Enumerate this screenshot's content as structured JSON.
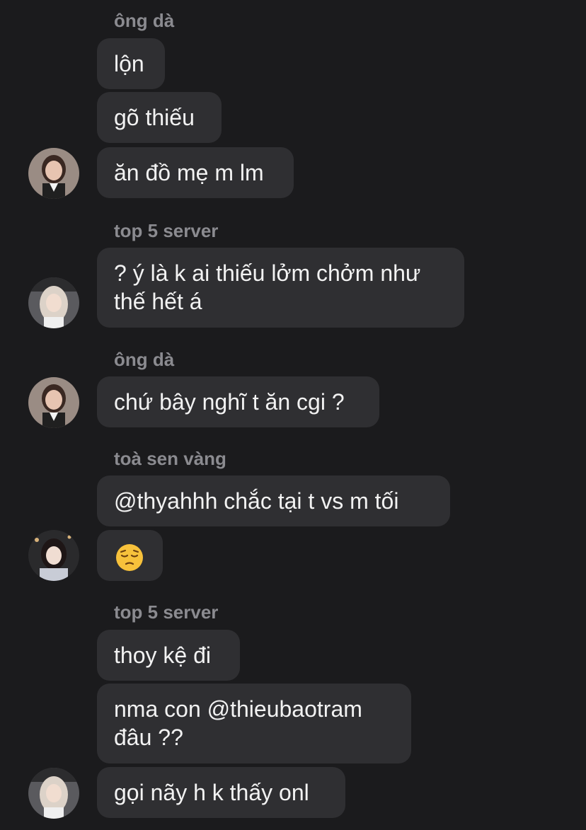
{
  "messages": [
    {
      "sender": "ông dà"
    },
    {
      "text": "lộn"
    },
    {
      "text": "gõ thiếu"
    },
    {
      "text": "ăn đồ mẹ m lm"
    },
    {
      "sender": "top 5 server"
    },
    {
      "line1": "? ý là k ai thiếu lởm chởm như",
      "line2": "thế hết á"
    },
    {
      "sender": "ông dà"
    },
    {
      "text": "chứ bây nghĩ t ăn cgi ?"
    },
    {
      "sender": "toà sen vàng"
    },
    {
      "text": "@thyahhh chắc tại t vs m tối"
    },
    {
      "emoji": "pensive-face"
    },
    {
      "sender": "top 5 server"
    },
    {
      "text": "thoy kệ đi"
    },
    {
      "line1": "nma con @thieubaotram",
      "line2": "đâu ??"
    },
    {
      "text": "gọi nãy h k thấy onl"
    }
  ],
  "colors": {
    "background": "#1b1b1d",
    "bubble": "#2f2f32",
    "sender_name": "#8b8b90",
    "message_text": "#f2f2f2"
  }
}
